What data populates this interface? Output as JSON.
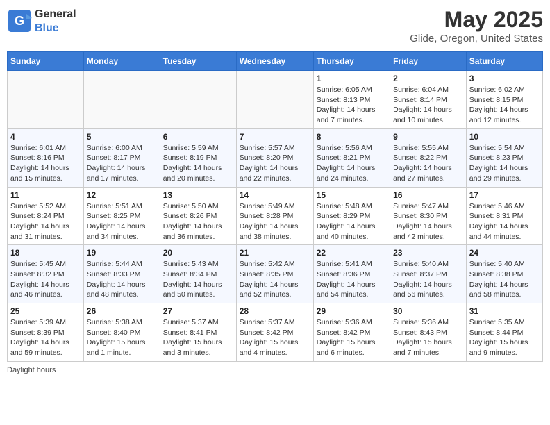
{
  "header": {
    "logo_general": "General",
    "logo_blue": "Blue",
    "title": "May 2025",
    "location": "Glide, Oregon, United States"
  },
  "weekdays": [
    "Sunday",
    "Monday",
    "Tuesday",
    "Wednesday",
    "Thursday",
    "Friday",
    "Saturday"
  ],
  "weeks": [
    [
      {
        "day": "",
        "info": ""
      },
      {
        "day": "",
        "info": ""
      },
      {
        "day": "",
        "info": ""
      },
      {
        "day": "",
        "info": ""
      },
      {
        "day": "1",
        "info": "Sunrise: 6:05 AM\nSunset: 8:13 PM\nDaylight: 14 hours\nand 7 minutes."
      },
      {
        "day": "2",
        "info": "Sunrise: 6:04 AM\nSunset: 8:14 PM\nDaylight: 14 hours\nand 10 minutes."
      },
      {
        "day": "3",
        "info": "Sunrise: 6:02 AM\nSunset: 8:15 PM\nDaylight: 14 hours\nand 12 minutes."
      }
    ],
    [
      {
        "day": "4",
        "info": "Sunrise: 6:01 AM\nSunset: 8:16 PM\nDaylight: 14 hours\nand 15 minutes."
      },
      {
        "day": "5",
        "info": "Sunrise: 6:00 AM\nSunset: 8:17 PM\nDaylight: 14 hours\nand 17 minutes."
      },
      {
        "day": "6",
        "info": "Sunrise: 5:59 AM\nSunset: 8:19 PM\nDaylight: 14 hours\nand 20 minutes."
      },
      {
        "day": "7",
        "info": "Sunrise: 5:57 AM\nSunset: 8:20 PM\nDaylight: 14 hours\nand 22 minutes."
      },
      {
        "day": "8",
        "info": "Sunrise: 5:56 AM\nSunset: 8:21 PM\nDaylight: 14 hours\nand 24 minutes."
      },
      {
        "day": "9",
        "info": "Sunrise: 5:55 AM\nSunset: 8:22 PM\nDaylight: 14 hours\nand 27 minutes."
      },
      {
        "day": "10",
        "info": "Sunrise: 5:54 AM\nSunset: 8:23 PM\nDaylight: 14 hours\nand 29 minutes."
      }
    ],
    [
      {
        "day": "11",
        "info": "Sunrise: 5:52 AM\nSunset: 8:24 PM\nDaylight: 14 hours\nand 31 minutes."
      },
      {
        "day": "12",
        "info": "Sunrise: 5:51 AM\nSunset: 8:25 PM\nDaylight: 14 hours\nand 34 minutes."
      },
      {
        "day": "13",
        "info": "Sunrise: 5:50 AM\nSunset: 8:26 PM\nDaylight: 14 hours\nand 36 minutes."
      },
      {
        "day": "14",
        "info": "Sunrise: 5:49 AM\nSunset: 8:28 PM\nDaylight: 14 hours\nand 38 minutes."
      },
      {
        "day": "15",
        "info": "Sunrise: 5:48 AM\nSunset: 8:29 PM\nDaylight: 14 hours\nand 40 minutes."
      },
      {
        "day": "16",
        "info": "Sunrise: 5:47 AM\nSunset: 8:30 PM\nDaylight: 14 hours\nand 42 minutes."
      },
      {
        "day": "17",
        "info": "Sunrise: 5:46 AM\nSunset: 8:31 PM\nDaylight: 14 hours\nand 44 minutes."
      }
    ],
    [
      {
        "day": "18",
        "info": "Sunrise: 5:45 AM\nSunset: 8:32 PM\nDaylight: 14 hours\nand 46 minutes."
      },
      {
        "day": "19",
        "info": "Sunrise: 5:44 AM\nSunset: 8:33 PM\nDaylight: 14 hours\nand 48 minutes."
      },
      {
        "day": "20",
        "info": "Sunrise: 5:43 AM\nSunset: 8:34 PM\nDaylight: 14 hours\nand 50 minutes."
      },
      {
        "day": "21",
        "info": "Sunrise: 5:42 AM\nSunset: 8:35 PM\nDaylight: 14 hours\nand 52 minutes."
      },
      {
        "day": "22",
        "info": "Sunrise: 5:41 AM\nSunset: 8:36 PM\nDaylight: 14 hours\nand 54 minutes."
      },
      {
        "day": "23",
        "info": "Sunrise: 5:40 AM\nSunset: 8:37 PM\nDaylight: 14 hours\nand 56 minutes."
      },
      {
        "day": "24",
        "info": "Sunrise: 5:40 AM\nSunset: 8:38 PM\nDaylight: 14 hours\nand 58 minutes."
      }
    ],
    [
      {
        "day": "25",
        "info": "Sunrise: 5:39 AM\nSunset: 8:39 PM\nDaylight: 14 hours\nand 59 minutes."
      },
      {
        "day": "26",
        "info": "Sunrise: 5:38 AM\nSunset: 8:40 PM\nDaylight: 15 hours\nand 1 minute."
      },
      {
        "day": "27",
        "info": "Sunrise: 5:37 AM\nSunset: 8:41 PM\nDaylight: 15 hours\nand 3 minutes."
      },
      {
        "day": "28",
        "info": "Sunrise: 5:37 AM\nSunset: 8:42 PM\nDaylight: 15 hours\nand 4 minutes."
      },
      {
        "day": "29",
        "info": "Sunrise: 5:36 AM\nSunset: 8:42 PM\nDaylight: 15 hours\nand 6 minutes."
      },
      {
        "day": "30",
        "info": "Sunrise: 5:36 AM\nSunset: 8:43 PM\nDaylight: 15 hours\nand 7 minutes."
      },
      {
        "day": "31",
        "info": "Sunrise: 5:35 AM\nSunset: 8:44 PM\nDaylight: 15 hours\nand 9 minutes."
      }
    ]
  ],
  "footer": {
    "daylight_label": "Daylight hours"
  }
}
